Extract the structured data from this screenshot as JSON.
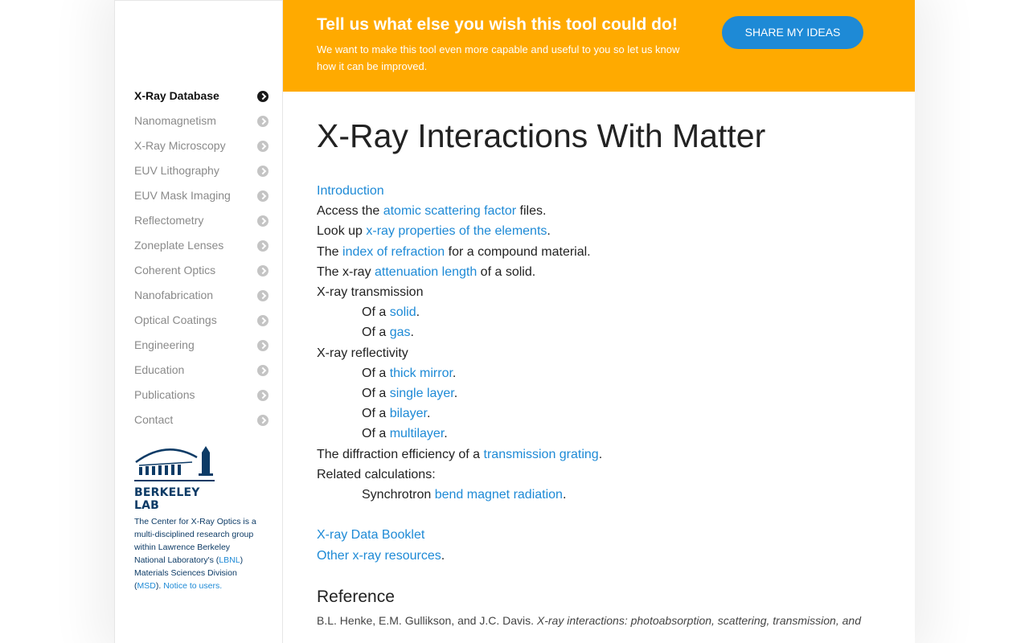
{
  "banner": {
    "title": "Tell us what else you wish this tool could do!",
    "subtitle": "We want to make this tool even more capable and useful to you so let us know how it can be improved.",
    "button_label": "SHARE MY IDEAS"
  },
  "sidebar": {
    "items": [
      {
        "label": "X-Ray Database",
        "active": true
      },
      {
        "label": "Nanomagnetism"
      },
      {
        "label": "X-Ray Microscopy"
      },
      {
        "label": "EUV Lithography"
      },
      {
        "label": "EUV Mask Imaging"
      },
      {
        "label": "Reflectometry"
      },
      {
        "label": "Zoneplate Lenses"
      },
      {
        "label": "Coherent Optics"
      },
      {
        "label": "Nanofabrication"
      },
      {
        "label": "Optical Coatings"
      },
      {
        "label": "Engineering"
      },
      {
        "label": "Education"
      },
      {
        "label": "Publications"
      },
      {
        "label": "Contact"
      }
    ],
    "logo_text": "BERKELEY LAB",
    "about": {
      "t1": "The Center for X-Ray Optics is a multi-disciplined research group within Lawrence Berkeley National Laboratory's (",
      "lbnl": "LBNL",
      "t2": ") Materials Sciences Division (",
      "msd": "MSD",
      "t3": "). ",
      "notice": "Notice to users."
    }
  },
  "main": {
    "title": "X-Ray Interactions With Matter",
    "intro": "Introduction",
    "l1_pre": "Access the ",
    "l1_link": "atomic scattering factor",
    "l1_post": " files.",
    "l2_pre": "Look up ",
    "l2_link": "x-ray properties of the elements",
    "l2_post": ".",
    "l3_pre": "The ",
    "l3_link": "index of refraction",
    "l3_post": " for a compound material.",
    "l4_pre": "The x-ray ",
    "l4_link": "attenuation length",
    "l4_post": " of a solid.",
    "transmission": "X-ray transmission",
    "of_a": "Of a ",
    "dot": ".",
    "t_solid": "solid",
    "t_gas": "gas",
    "reflectivity": "X-ray reflectivity",
    "r_thick": "thick mirror",
    "r_single": "single layer",
    "r_bilayer": "bilayer",
    "r_multi": "multilayer",
    "diff_pre": "The diffraction efficiency of a ",
    "diff_link": "transmission grating",
    "diff_post": ".",
    "related": "Related calculations:",
    "sync_pre": "Synchrotron ",
    "sync_link": "bend magnet radiation",
    "sync_post": ".",
    "booklet": "X-ray Data Booklet",
    "other_link": "Other x-ray resources",
    "other_post": ".",
    "ref_heading": "Reference",
    "ref_authors": "B.L. Henke, E.M. Gullikson, and J.C. Davis. ",
    "ref_title": "X-ray interactions: photoabsorption, scattering, transmission, and"
  }
}
